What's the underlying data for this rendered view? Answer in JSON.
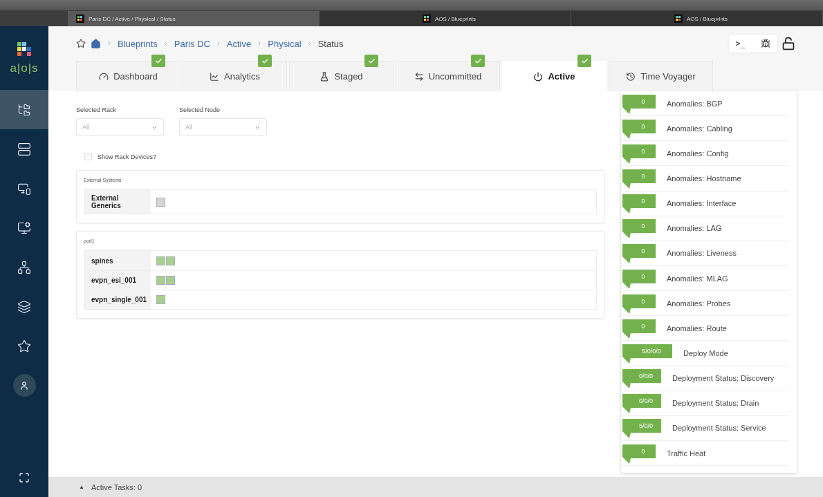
{
  "browser_tabs": [
    {
      "title": "Paris DC / Active / Physical / Status",
      "selected": true
    },
    {
      "title": "AOS / Blueprints",
      "selected": false
    },
    {
      "title": "AOS / Blueprints",
      "selected": false
    }
  ],
  "logo": {
    "text": "a|o|s"
  },
  "sidebar": {
    "items": [
      {
        "selected": true
      },
      {
        "selected": false
      },
      {
        "selected": false
      },
      {
        "selected": false
      },
      {
        "selected": false
      },
      {
        "selected": false
      },
      {
        "selected": false
      },
      {
        "kind": "user",
        "selected": false
      }
    ]
  },
  "breadcrumb": [
    "Blueprints",
    "Paris DC",
    "Active",
    "Physical",
    "Status"
  ],
  "tabs": [
    {
      "label": "Dashboard",
      "checked": true,
      "selected": false
    },
    {
      "label": "Analytics",
      "checked": true,
      "selected": false
    },
    {
      "label": "Staged",
      "checked": true,
      "selected": false
    },
    {
      "label": "Uncommitted",
      "checked": true,
      "selected": false
    },
    {
      "label": "Active",
      "checked": true,
      "selected": true
    },
    {
      "label": "Time Voyager",
      "checked": false,
      "selected": false
    }
  ],
  "filters": [
    {
      "label": "Selected Rack",
      "value": "All"
    },
    {
      "label": "Selected Node",
      "value": "All"
    }
  ],
  "show_rack_devices": {
    "label": "Show Rack Devices?",
    "checked": false
  },
  "groups": [
    {
      "title": "External Systems",
      "rows": [
        {
          "name": "External Generics",
          "nodes": [
            {
              "color": "#d3d6d6"
            }
          ]
        }
      ]
    },
    {
      "title": "pod1",
      "rows": [
        {
          "name": "spines",
          "nodes": [
            {
              "color": "#a9cf8f"
            },
            {
              "color": "#a9cf8f"
            }
          ]
        },
        {
          "name": "evpn_esi_001",
          "nodes": [
            {
              "color": "#a9cf8f"
            },
            {
              "color": "#a9cf8f"
            }
          ]
        },
        {
          "name": "evpn_single_001",
          "nodes": [
            {
              "color": "#a9cf8f"
            }
          ]
        }
      ]
    }
  ],
  "status_list": [
    {
      "count": "0",
      "label": "Anomalies: BGP"
    },
    {
      "count": "0",
      "label": "Anomalies: Cabling"
    },
    {
      "count": "0",
      "label": "Anomalies: Config"
    },
    {
      "count": "0",
      "label": "Anomalies: Hostname"
    },
    {
      "count": "0",
      "label": "Anomalies: Interface"
    },
    {
      "count": "0",
      "label": "Anomalies: LAG"
    },
    {
      "count": "0",
      "label": "Anomalies: Liveness"
    },
    {
      "count": "0",
      "label": "Anomalies: MLAG"
    },
    {
      "count": "0",
      "label": "Anomalies: Probes"
    },
    {
      "count": "0",
      "label": "Anomalies: Route"
    },
    {
      "count": "5/0/0/0",
      "label": "Deploy Mode"
    },
    {
      "count": "0/0/0",
      "label": "Deployment Status: Discovery"
    },
    {
      "count": "0/0/0",
      "label": "Deployment Status: Drain"
    },
    {
      "count": "5/0/0",
      "label": "Deployment Status: Service"
    },
    {
      "count": "0",
      "label": "Traffic Heat"
    }
  ],
  "tools": {
    "terminal": ">_",
    "locked": false
  },
  "status_bar": {
    "toggle": "▲",
    "text": "Active Tasks: 0"
  }
}
